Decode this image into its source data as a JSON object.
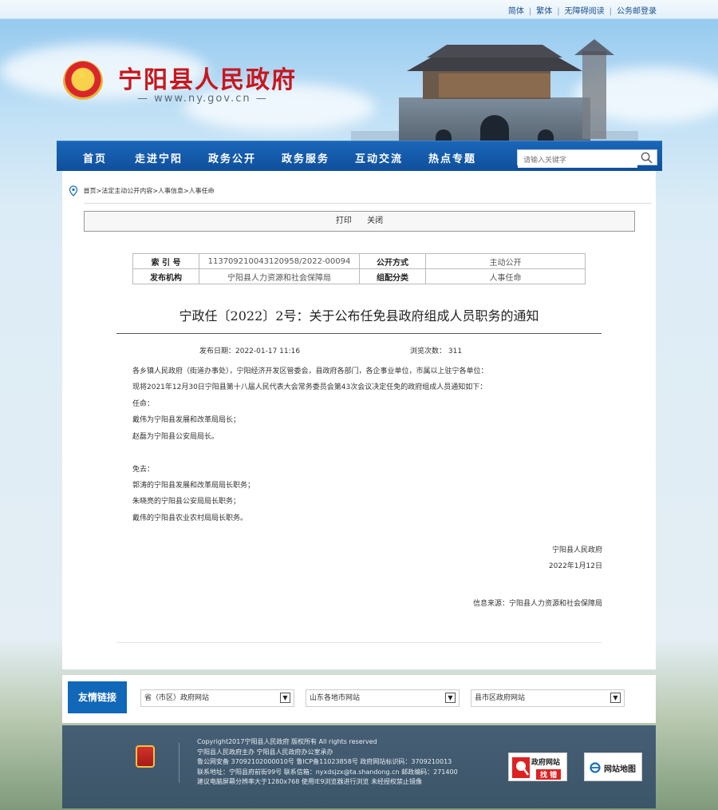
{
  "topbar": {
    "links": [
      "简体",
      "繁体",
      "无障碍阅读",
      "公务邮登录"
    ]
  },
  "header": {
    "title": "宁阳县人民政府",
    "url": "— www.ny.gov.cn —"
  },
  "nav": {
    "items": [
      "首页",
      "走进宁阳",
      "政务公开",
      "政务服务",
      "互动交流",
      "热点专题"
    ],
    "search_placeholder": "请输入关键字"
  },
  "breadcrumb": "首页>法定主动公开内容>人事信息>人事任命",
  "toolbar": {
    "print": "打印",
    "close": "关闭"
  },
  "meta": {
    "index_label": "索 引 号",
    "index_value": "113709210043120958/2022-00094",
    "open_label": "公开方式",
    "open_value": "主动公开",
    "org_label": "发布机构",
    "org_value": "宁阳县人力资源和社会保障局",
    "category_label": "组配分类",
    "category_value": "人事任命"
  },
  "article": {
    "title": "宁政任〔2022〕2号：关于公布任免县政府组成人员职务的通知",
    "publish_date": "发布日期：2022-01-17 11:16",
    "views": "浏览次数： 311",
    "lines": [
      "各乡镇人民政府（街道办事处），宁阳经济开发区管委会，县政府各部门，各企事业单位，市属以上驻宁各单位：",
      "现将2021年12月30日宁阳县第十八届人民代表大会常务委员会第43次会议决定任免的政府组成人员通知如下：",
      "任命：",
      "戴伟为宁阳县发展和改革局局长；",
      "赵磊为宁阳县公安局局长。",
      "免去：",
      "郭涛的宁阳县发展和改革局局长职务；",
      "朱晓亮的宁阳县公安局局长职务；",
      "戴伟的宁阳县农业农村局局长职务。"
    ],
    "signature": "宁阳县人民政府",
    "sign_date": "2022年1月12日",
    "source": "信息来源：宁阳县人力资源和社会保障局"
  },
  "friendly_links": {
    "title": "友情链接",
    "selects": [
      "省（市区）政府网站",
      "山东各地市网站",
      "县市区政府网站"
    ]
  },
  "footer": {
    "lines": [
      "Copyright2017宁阳县人民政府 版权所有 All rights reserved",
      "宁阳县人民政府主办 宁阳县人民政府办公室承办",
      "鲁公网安备 37092102000010号 鲁ICP备11023858号 政府网站标识码：3709210013",
      "联系地址：宁阳县府前街99号 联系信箱：nyxdsjzx@ta.shandong.cn 邮政编码：271400",
      "建议电脑屏幕分辨率大于1280x768 使用IE9浏览器进行浏览 未经授权禁止镜像"
    ],
    "badge_error_title": "政府网站",
    "badge_error_sub": "找 错",
    "badge_sitemap": "网站地图"
  },
  "colors": {
    "brand_red": "#c8161d",
    "nav_blue": "#1167b8"
  }
}
